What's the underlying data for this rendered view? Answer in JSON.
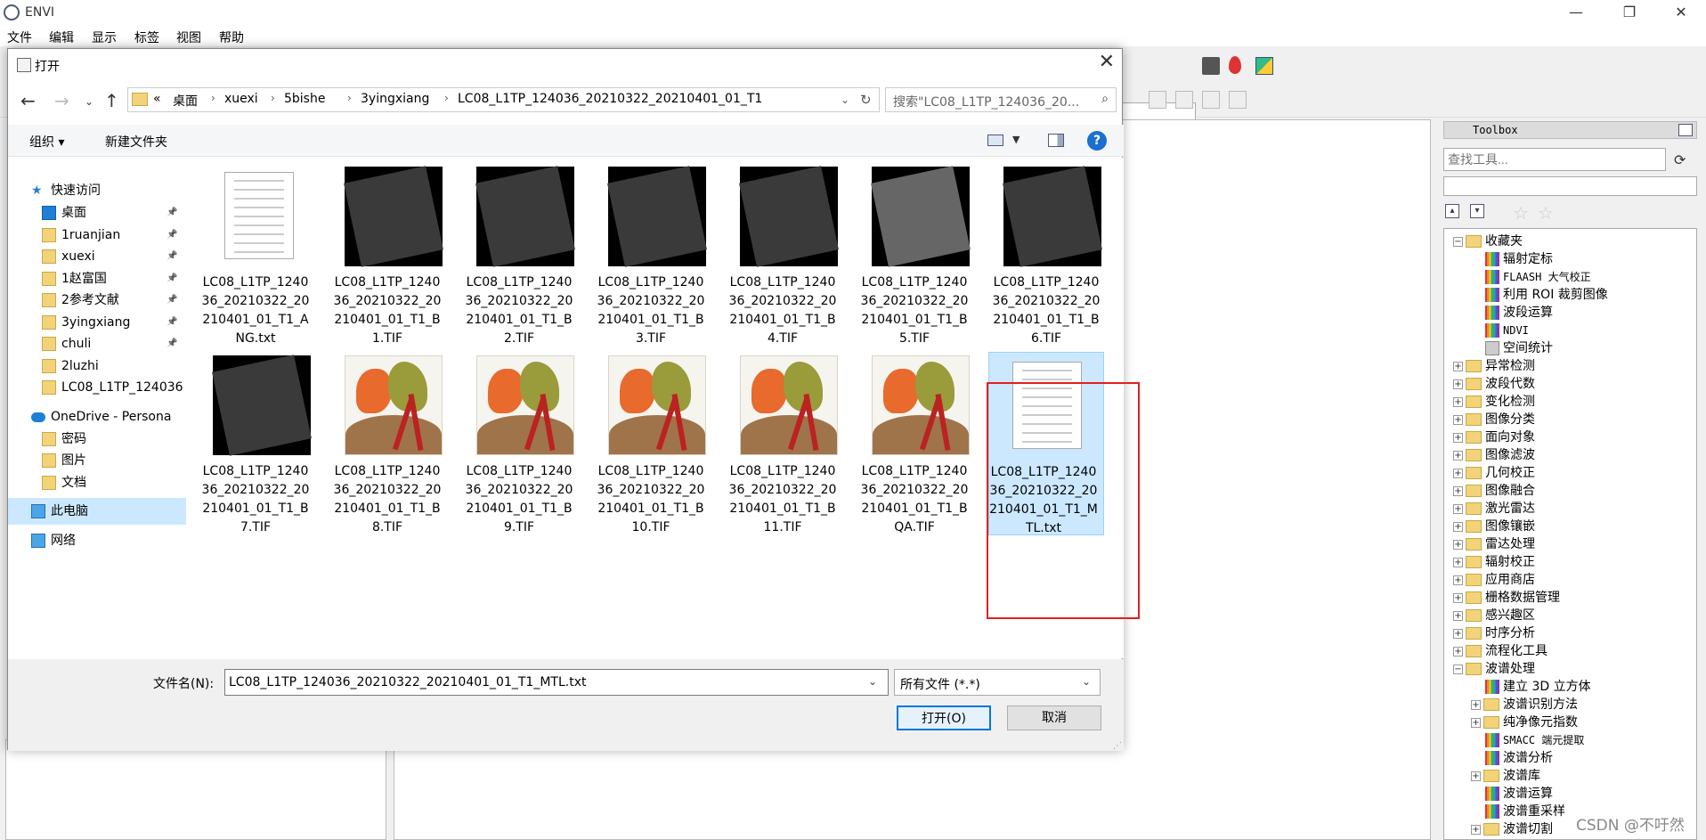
{
  "app": {
    "title": "ENVI"
  },
  "menubar": [
    "文件",
    "编辑",
    "显示",
    "标签",
    "视图",
    "帮助"
  ],
  "toolbox": {
    "title": "Toolbox",
    "search_placeholder": "查找工具...",
    "tree": [
      {
        "label": "收藏夹",
        "type": "folder",
        "expanded": true,
        "level": 0
      },
      {
        "label": "辐射定标",
        "type": "tool",
        "level": 1
      },
      {
        "label": "FLAASH 大气校正",
        "type": "tool",
        "level": 1
      },
      {
        "label": "利用 ROI 裁剪图像",
        "type": "tool",
        "level": 1
      },
      {
        "label": "波段运算",
        "type": "tool",
        "level": 1
      },
      {
        "label": "NDVI",
        "type": "tool",
        "level": 1
      },
      {
        "label": "空间统计",
        "type": "tool",
        "level": 1
      },
      {
        "label": "异常检测",
        "type": "folder",
        "level": 0
      },
      {
        "label": "波段代数",
        "type": "folder",
        "level": 0
      },
      {
        "label": "变化检测",
        "type": "folder",
        "level": 0
      },
      {
        "label": "图像分类",
        "type": "folder",
        "level": 0
      },
      {
        "label": "面向对象",
        "type": "folder",
        "level": 0
      },
      {
        "label": "图像滤波",
        "type": "folder",
        "level": 0
      },
      {
        "label": "几何校正",
        "type": "folder",
        "level": 0
      },
      {
        "label": "图像融合",
        "type": "folder",
        "level": 0
      },
      {
        "label": "激光雷达",
        "type": "folder",
        "level": 0
      },
      {
        "label": "图像镶嵌",
        "type": "folder",
        "level": 0
      },
      {
        "label": "雷达处理",
        "type": "folder",
        "level": 0
      },
      {
        "label": "辐射校正",
        "type": "folder",
        "level": 0
      },
      {
        "label": "应用商店",
        "type": "folder",
        "level": 0
      },
      {
        "label": "栅格数据管理",
        "type": "folder",
        "level": 0
      },
      {
        "label": "感兴趣区",
        "type": "folder",
        "level": 0
      },
      {
        "label": "时序分析",
        "type": "folder",
        "level": 0
      },
      {
        "label": "流程化工具",
        "type": "folder",
        "level": 0
      },
      {
        "label": "波谱处理",
        "type": "folder",
        "expanded": true,
        "level": 0
      },
      {
        "label": "建立 3D 立方体",
        "type": "tool",
        "level": 1
      },
      {
        "label": "波谱识别方法",
        "type": "folder",
        "level": 1
      },
      {
        "label": "纯净像元指数",
        "type": "folder",
        "level": 1
      },
      {
        "label": "SMACC 端元提取",
        "type": "tool",
        "level": 1
      },
      {
        "label": "波谱分析",
        "type": "tool",
        "level": 1
      },
      {
        "label": "波谱库",
        "type": "folder",
        "level": 1
      },
      {
        "label": "波谱运算",
        "type": "tool",
        "level": 1
      },
      {
        "label": "波谱重采样",
        "type": "tool",
        "level": 1
      },
      {
        "label": "波谱切割",
        "type": "folder",
        "level": 1
      }
    ]
  },
  "dialog": {
    "title": "打开",
    "breadcrumb": [
      "«",
      "桌面",
      "xuexi",
      "5bishe",
      "3yingxiang",
      "LC08_L1TP_124036_20210322_20210401_01_T1"
    ],
    "search_placeholder": "搜索\"LC08_L1TP_124036_20...",
    "commands": {
      "organize": "组织 ▾",
      "new_folder": "新建文件夹"
    },
    "nav": [
      {
        "label": "快速访问",
        "kind": "quick",
        "indent": 0
      },
      {
        "label": "桌面",
        "kind": "desktop",
        "indent": 1,
        "pinned": true
      },
      {
        "label": "1ruanjian",
        "kind": "folder",
        "indent": 1,
        "pinned": true
      },
      {
        "label": "xuexi",
        "kind": "folder",
        "indent": 1,
        "pinned": true
      },
      {
        "label": "1赵富国",
        "kind": "folder",
        "indent": 1,
        "pinned": true
      },
      {
        "label": "2参考文献",
        "kind": "folder",
        "indent": 1,
        "pinned": true
      },
      {
        "label": "3yingxiang",
        "kind": "folder",
        "indent": 1,
        "pinned": true
      },
      {
        "label": "chuli",
        "kind": "folder",
        "indent": 1,
        "pinned": true
      },
      {
        "label": "2luzhi",
        "kind": "folder",
        "indent": 1,
        "pinned": false
      },
      {
        "label": "LC08_L1TP_124036",
        "kind": "folder",
        "indent": 1,
        "pinned": false
      },
      {
        "label": "OneDrive - Persona",
        "kind": "cloud",
        "indent": 0
      },
      {
        "label": "密码",
        "kind": "folder",
        "indent": 1,
        "pinned": false
      },
      {
        "label": "图片",
        "kind": "folder",
        "indent": 1,
        "pinned": false
      },
      {
        "label": "文档",
        "kind": "folder",
        "indent": 1,
        "pinned": false
      },
      {
        "label": "此电脑",
        "kind": "pc",
        "indent": 0,
        "selected": true
      },
      {
        "label": "网络",
        "kind": "network",
        "indent": 0
      }
    ],
    "files": [
      {
        "name": "LC08_L1TP_124036_20210322_20210401_01_T1_ANG.txt",
        "kind": "text"
      },
      {
        "name": "LC08_L1TP_124036_20210322_20210401_01_T1_B1.TIF",
        "kind": "satellite"
      },
      {
        "name": "LC08_L1TP_124036_20210322_20210401_01_T1_B2.TIF",
        "kind": "satellite"
      },
      {
        "name": "LC08_L1TP_124036_20210322_20210401_01_T1_B3.TIF",
        "kind": "satellite"
      },
      {
        "name": "LC08_L1TP_124036_20210322_20210401_01_T1_B4.TIF",
        "kind": "satellite"
      },
      {
        "name": "LC08_L1TP_124036_20210322_20210401_01_T1_B5.TIF",
        "kind": "satellite-light"
      },
      {
        "name": "LC08_L1TP_124036_20210322_20210401_01_T1_B6.TIF",
        "kind": "satellite"
      },
      {
        "name": "LC08_L1TP_124036_20210322_20210401_01_T1_B7.TIF",
        "kind": "satellite"
      },
      {
        "name": "LC08_L1TP_124036_20210322_20210401_01_T1_B8.TIF",
        "kind": "paint"
      },
      {
        "name": "LC08_L1TP_124036_20210322_20210401_01_T1_B9.TIF",
        "kind": "paint"
      },
      {
        "name": "LC08_L1TP_124036_20210322_20210401_01_T1_B10.TIF",
        "kind": "paint"
      },
      {
        "name": "LC08_L1TP_124036_20210322_20210401_01_T1_B11.TIF",
        "kind": "paint"
      },
      {
        "name": "LC08_L1TP_124036_20210322_20210401_01_T1_BQA.TIF",
        "kind": "paint"
      },
      {
        "name": "LC08_L1TP_124036_20210322_20210401_01_T1_MTL.txt",
        "kind": "text",
        "selected": true
      }
    ],
    "filename_label": "文件名(N):",
    "filename_value": "LC08_L1TP_124036_20210322_20210401_01_T1_MTL.txt",
    "filetype": "所有文件 (*.*)",
    "open_button": "打开(O)",
    "cancel_button": "取消"
  },
  "watermark": "CSDN @不吁然"
}
